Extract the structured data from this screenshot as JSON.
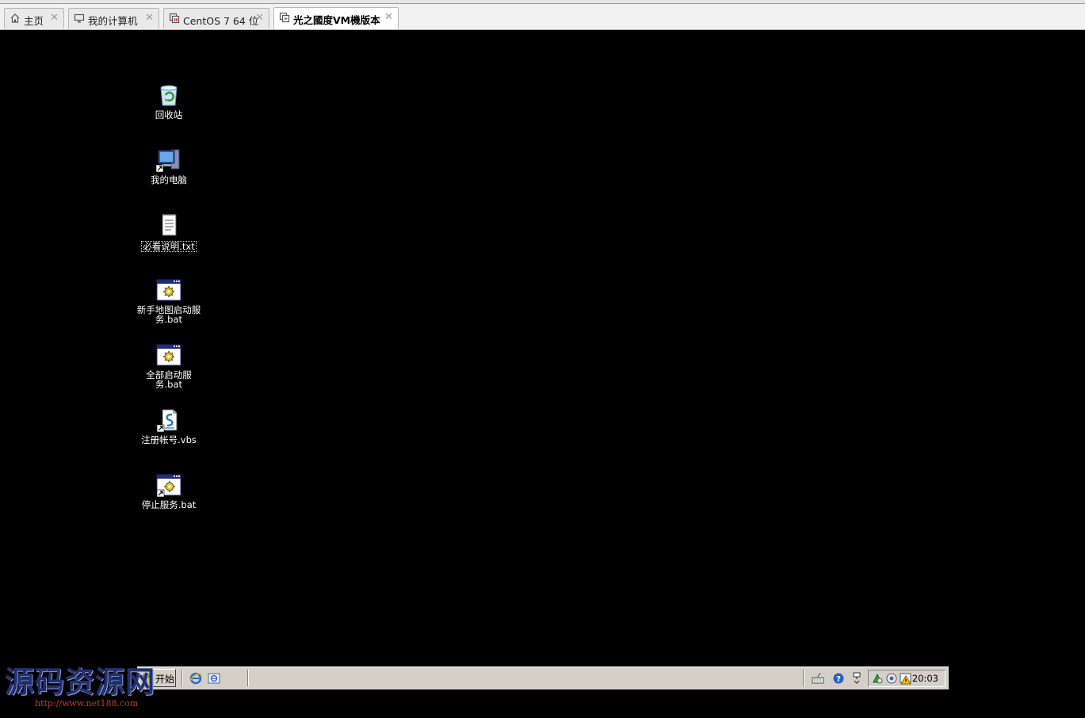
{
  "tabs": [
    {
      "label": "主页",
      "icon": "home-icon",
      "active": false
    },
    {
      "label": "我的计算机",
      "icon": "computer-icon",
      "active": false
    },
    {
      "label": "CentOS 7 64 位",
      "icon": "vm-icon",
      "active": false
    },
    {
      "label": "光之國度VM機版本",
      "icon": "vm-running-icon",
      "active": true
    }
  ],
  "desktop": {
    "icons": [
      {
        "label": "回收站",
        "icon": "recycle-bin-icon"
      },
      {
        "label": "我的电脑",
        "icon": "my-computer-icon"
      },
      {
        "label": "必看说明.txt",
        "icon": "text-file-icon"
      },
      {
        "label": "新手地图启动服务.bat",
        "icon": "batch-file-icon"
      },
      {
        "label": "全部启动服务.bat",
        "icon": "batch-file-icon"
      },
      {
        "label": "注册帐号.vbs",
        "icon": "vbs-script-icon"
      },
      {
        "label": "停止服务.bat",
        "icon": "batch-file-icon"
      }
    ]
  },
  "taskbar": {
    "start_label": "开始",
    "quick_launch": [
      "internet-explorer-icon",
      "show-desktop-icon"
    ],
    "tray_icons": [
      "keyboard-icon",
      "help-icon",
      "network-icon",
      "shield-icon",
      "volume-icon",
      "warning-icon"
    ],
    "clock": "20:03"
  },
  "watermark": {
    "title": "源码资源网",
    "url": "http://www.net188.com"
  },
  "colors": {
    "vm_background": "#000000",
    "taskbar": "#d4d0c8",
    "tab_strip": "#f1f1f1"
  }
}
